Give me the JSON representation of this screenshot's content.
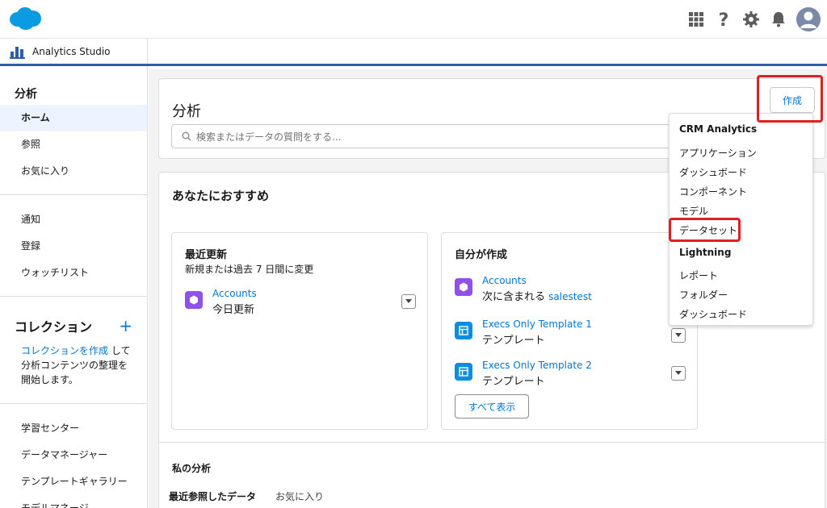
{
  "colors": {
    "brand": "#0176d3",
    "accent_bar": "#2e5ea8",
    "highlight": "#e02020",
    "dataset_icon": "#9050e9",
    "template_icon": "#0b8de0"
  },
  "header": {
    "icons": [
      "salesforce-cloud-logo",
      "app-launcher-icon",
      "help-icon",
      "setup-gear-icon",
      "notification-bell-icon",
      "user-avatar"
    ]
  },
  "appbar": {
    "app_name": "Analytics Studio"
  },
  "sidebar": {
    "title": "分析",
    "nav_primary": [
      {
        "label": "ホーム",
        "active": true
      },
      {
        "label": "参照",
        "active": false
      },
      {
        "label": "お気に入り",
        "active": false
      }
    ],
    "nav_secondary": [
      {
        "label": "通知"
      },
      {
        "label": "登録"
      },
      {
        "label": "ウォッチリスト"
      }
    ],
    "collections": {
      "title": "コレクション",
      "plus": "+",
      "create_link": "コレクションを作成",
      "desc_rest": " して分析コンテンツの整理を開始します。"
    },
    "nav_tertiary": [
      {
        "label": "学習センター"
      },
      {
        "label": "データマネージャー"
      },
      {
        "label": "テンプレートギャラリー"
      },
      {
        "label": "モデルマネージ"
      }
    ]
  },
  "main": {
    "title": "分析",
    "search_placeholder": "検索またはデータの質問をする...",
    "create_button": "作成",
    "recommend_title": "あなたにおすすめ",
    "recent": {
      "title": "最近更新",
      "desc": "新規または過去 7 日間に変更",
      "items": [
        {
          "name": "Accounts",
          "sub": "今日更新"
        }
      ]
    },
    "mine": {
      "title": "自分が作成",
      "items": [
        {
          "name": "Accounts",
          "sub": "次に含まれる",
          "sub_link": "salestest"
        },
        {
          "name": "Execs Only Template 1",
          "sub": "テンプレート"
        },
        {
          "name": "Execs Only Template 2",
          "sub": "テンプレート"
        }
      ],
      "show_all": "すべて表示"
    },
    "my_analytics_title": "私の分析",
    "tabs": [
      {
        "label": "最近参照したデータ",
        "active": true
      },
      {
        "label": "お気に入り",
        "active": false
      }
    ]
  },
  "create_menu": {
    "sections": [
      {
        "heading": "CRM Analytics",
        "items": [
          "アプリケーション",
          "ダッシュボード",
          "コンポーネント",
          "モデル",
          "データセット"
        ]
      },
      {
        "heading": "Lightning",
        "items": [
          "レポート",
          "フォルダー",
          "ダッシュボード"
        ]
      }
    ]
  }
}
